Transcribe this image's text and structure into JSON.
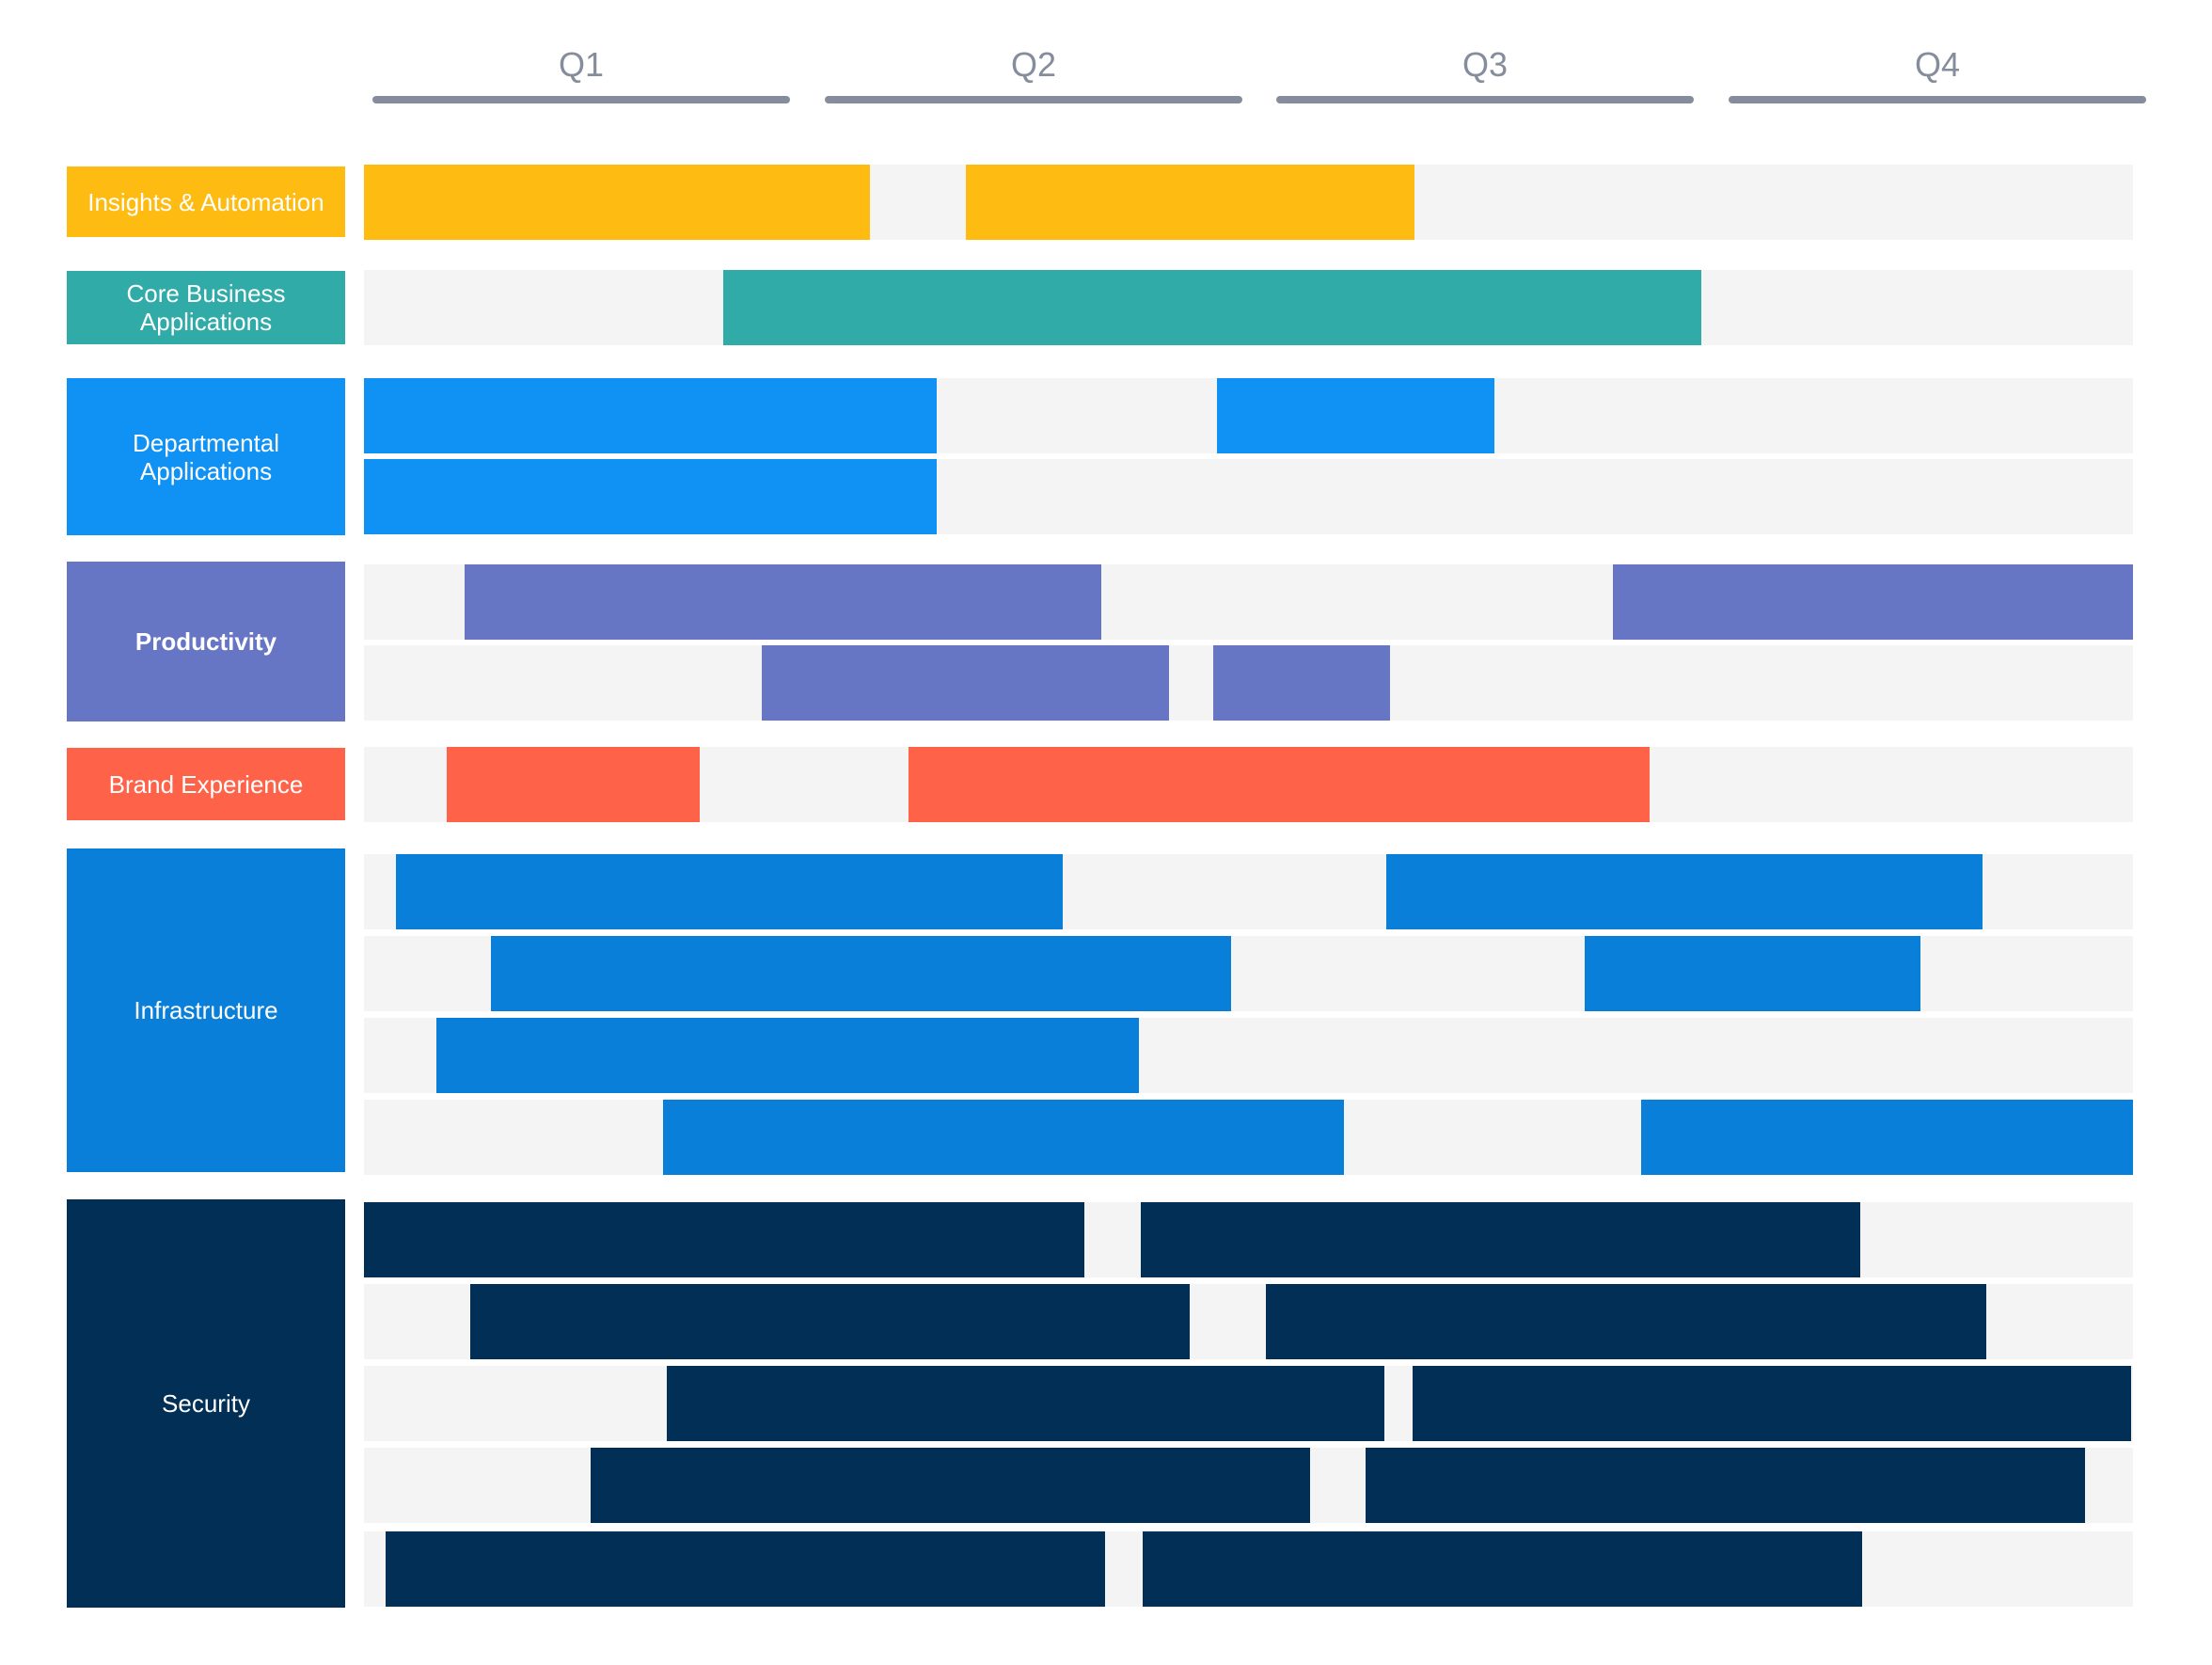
{
  "chart_data": {
    "type": "gantt",
    "title": "",
    "timeline": [
      "Q1",
      "Q2",
      "Q3",
      "Q4"
    ],
    "x_range": [
      0,
      1
    ],
    "x_unit": "fraction of year",
    "categories": [
      {
        "name": "Insights & Automation",
        "color": "#febb12",
        "bold": false,
        "rows": [
          [
            [
              0.0,
              0.286
            ],
            [
              0.34,
              0.594
            ]
          ]
        ]
      },
      {
        "name": "Core Business Applications",
        "color": "#30aba8",
        "bold": false,
        "rows": [
          [
            [
              0.203,
              0.756
            ]
          ]
        ]
      },
      {
        "name": "Departmental Applications",
        "color": "#1092f5",
        "bold": false,
        "rows": [
          [
            [
              0.0,
              0.324
            ],
            [
              0.482,
              0.639
            ]
          ],
          [
            [
              0.0,
              0.324
            ]
          ]
        ]
      },
      {
        "name": "Productivity",
        "color": "#6676c4",
        "bold": true,
        "rows": [
          [
            [
              0.057,
              0.417
            ],
            [
              0.706,
              1.0
            ]
          ],
          [
            [
              0.225,
              0.455
            ],
            [
              0.48,
              0.58
            ]
          ]
        ]
      },
      {
        "name": "Brand Experience",
        "color": "#fe634a",
        "bold": false,
        "rows": [
          [
            [
              0.047,
              0.19
            ],
            [
              0.308,
              0.727
            ]
          ]
        ]
      },
      {
        "name": "Infrastructure",
        "color": "#0a7fd9",
        "bold": false,
        "rows": [
          [
            [
              0.018,
              0.395
            ],
            [
              0.578,
              0.915
            ]
          ],
          [
            [
              0.072,
              0.49
            ],
            [
              0.69,
              0.88
            ]
          ],
          [
            [
              0.041,
              0.438
            ]
          ],
          [
            [
              0.169,
              0.554
            ],
            [
              0.722,
              1.0
            ]
          ]
        ]
      },
      {
        "name": "Security",
        "color": "#012f55",
        "bold": false,
        "rows": [
          [
            [
              0.0,
              0.407
            ],
            [
              0.439,
              0.846
            ]
          ],
          [
            [
              0.06,
              0.467
            ],
            [
              0.51,
              0.917
            ]
          ],
          [
            [
              0.171,
              0.577
            ],
            [
              0.593,
              0.999
            ]
          ],
          [
            [
              0.128,
              0.535
            ],
            [
              0.566,
              0.973
            ]
          ],
          [
            [
              0.012,
              0.419
            ],
            [
              0.44,
              0.847
            ]
          ]
        ]
      }
    ]
  }
}
